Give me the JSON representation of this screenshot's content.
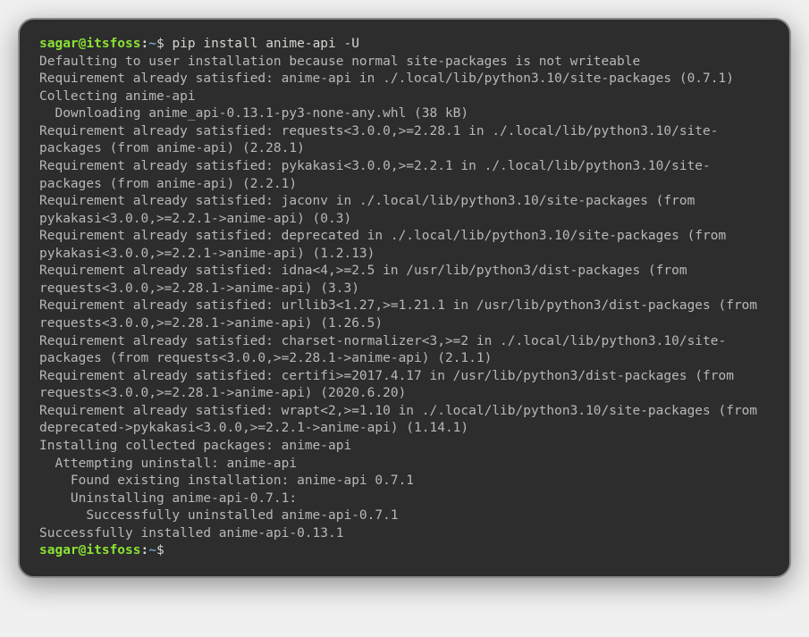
{
  "prompt": {
    "user": "sagar@itsfoss",
    "sep": ":",
    "path": "~",
    "dollar": "$"
  },
  "command": "pip install anime-api -U",
  "lines": {
    "l0": "Defaulting to user installation because normal site-packages is not writeable",
    "l1": "Requirement already satisfied: anime-api in ./.local/lib/python3.10/site-packages (0.7.1)",
    "l2": "Collecting anime-api",
    "l3": "  Downloading anime_api-0.13.1-py3-none-any.whl (38 kB)",
    "l4": "Requirement already satisfied: requests<3.0.0,>=2.28.1 in ./.local/lib/python3.10/site-packages (from anime-api) (2.28.1)",
    "l5": "Requirement already satisfied: pykakasi<3.0.0,>=2.2.1 in ./.local/lib/python3.10/site-packages (from anime-api) (2.2.1)",
    "l6": "Requirement already satisfied: jaconv in ./.local/lib/python3.10/site-packages (from pykakasi<3.0.0,>=2.2.1->anime-api) (0.3)",
    "l7": "Requirement already satisfied: deprecated in ./.local/lib/python3.10/site-packages (from pykakasi<3.0.0,>=2.2.1->anime-api) (1.2.13)",
    "l8": "Requirement already satisfied: idna<4,>=2.5 in /usr/lib/python3/dist-packages (from requests<3.0.0,>=2.28.1->anime-api) (3.3)",
    "l9": "Requirement already satisfied: urllib3<1.27,>=1.21.1 in /usr/lib/python3/dist-packages (from requests<3.0.0,>=2.28.1->anime-api) (1.26.5)",
    "l10": "Requirement already satisfied: charset-normalizer<3,>=2 in ./.local/lib/python3.10/site-packages (from requests<3.0.0,>=2.28.1->anime-api) (2.1.1)",
    "l11": "Requirement already satisfied: certifi>=2017.4.17 in /usr/lib/python3/dist-packages (from requests<3.0.0,>=2.28.1->anime-api) (2020.6.20)",
    "l12": "Requirement already satisfied: wrapt<2,>=1.10 in ./.local/lib/python3.10/site-packages (from deprecated->pykakasi<3.0.0,>=2.2.1->anime-api) (1.14.1)",
    "l13": "Installing collected packages: anime-api",
    "l14": "  Attempting uninstall: anime-api",
    "l15": "    Found existing installation: anime-api 0.7.1",
    "l16": "    Uninstalling anime-api-0.7.1:",
    "l17": "      Successfully uninstalled anime-api-0.7.1",
    "l18": "Successfully installed anime-api-0.13.1"
  }
}
